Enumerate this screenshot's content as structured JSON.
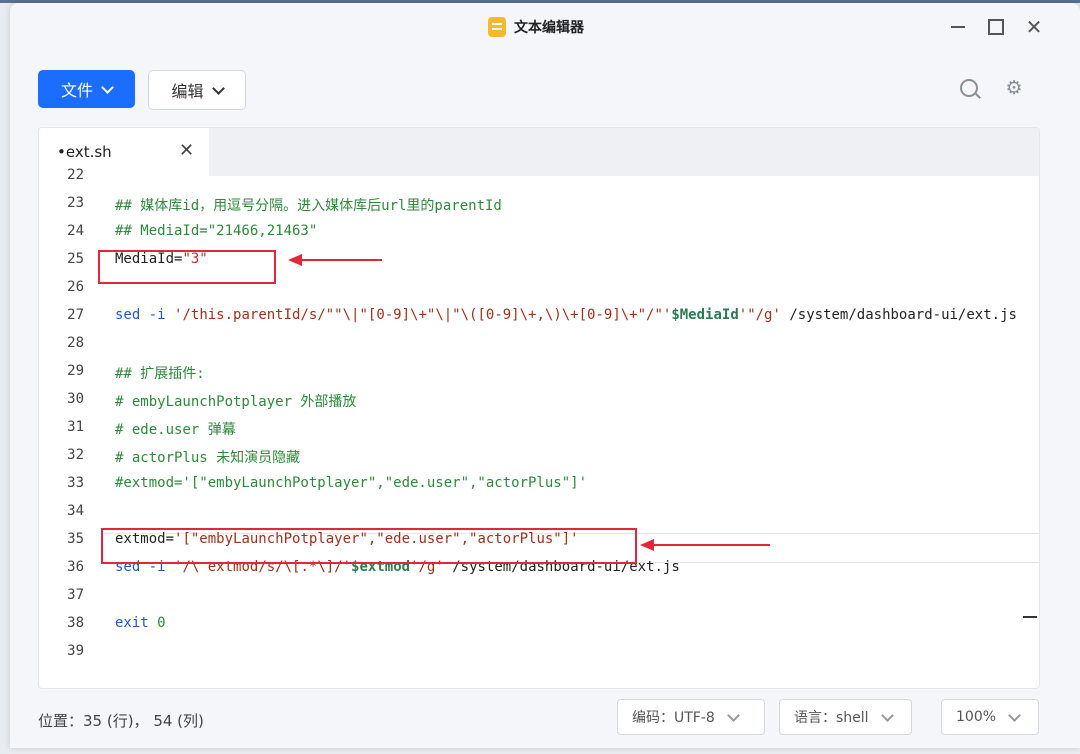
{
  "window": {
    "title": "文本编辑器"
  },
  "toolbar": {
    "file_label": "文件",
    "edit_label": "编辑"
  },
  "tab": {
    "name": "ext.sh",
    "modified_marker": "•"
  },
  "editor": {
    "lines": [
      {
        "n": "22",
        "segments": []
      },
      {
        "n": "23",
        "segments": [
          {
            "t": "## 媒体库id，用逗号分隔。进入媒体库后url里的parentId",
            "c": "c-comment"
          }
        ]
      },
      {
        "n": "24",
        "segments": [
          {
            "t": "## MediaId=\"21466,21463\"",
            "c": "c-comment"
          }
        ]
      },
      {
        "n": "25",
        "segments": [
          {
            "t": "MediaId=",
            "c": ""
          },
          {
            "t": "\"3\"",
            "c": "c-str"
          }
        ]
      },
      {
        "n": "26",
        "segments": []
      },
      {
        "n": "27",
        "segments": [
          {
            "t": "sed",
            "c": "c-kw"
          },
          {
            "t": " ",
            "c": ""
          },
          {
            "t": "-i",
            "c": "c-kw"
          },
          {
            "t": " ",
            "c": ""
          },
          {
            "t": "'/this.parentId/s/\"\"\\|\"[0-9]\\+\"\\|\"\\([0-9]\\+,\\)\\+[0-9]\\+\"/\"'",
            "c": "c-str2"
          },
          {
            "t": "$MediaId",
            "c": "c-var"
          },
          {
            "t": "'\"/g'",
            "c": "c-str2"
          },
          {
            "t": " /system/dashboard-ui/ext.js",
            "c": ""
          }
        ]
      },
      {
        "n": "28",
        "segments": []
      },
      {
        "n": "29",
        "segments": [
          {
            "t": "## 扩展插件:",
            "c": "c-comment"
          }
        ]
      },
      {
        "n": "30",
        "segments": [
          {
            "t": "# embyLaunchPotplayer 外部播放",
            "c": "c-comment"
          }
        ]
      },
      {
        "n": "31",
        "segments": [
          {
            "t": "# ede.user 弹幕",
            "c": "c-comment"
          }
        ]
      },
      {
        "n": "32",
        "segments": [
          {
            "t": "# actorPlus 未知演员隐藏",
            "c": "c-comment"
          }
        ]
      },
      {
        "n": "33",
        "segments": [
          {
            "t": "#extmod='[\"embyLaunchPotplayer\",\"ede.user\",\"actorPlus\"]'",
            "c": "c-comment"
          }
        ]
      },
      {
        "n": "34",
        "segments": []
      },
      {
        "n": "35",
        "segments": [
          {
            "t": "extmod=",
            "c": ""
          },
          {
            "t": "'[\"embyLaunchPotplayer\",\"ede.user\",\"actorPlus\"]'",
            "c": "c-str2"
          }
        ]
      },
      {
        "n": "36",
        "segments": [
          {
            "t": "sed",
            "c": "c-kw"
          },
          {
            "t": " ",
            "c": ""
          },
          {
            "t": "-i",
            "c": "c-kw"
          },
          {
            "t": " ",
            "c": ""
          },
          {
            "t": "'/\\ extmod/s/\\[.*\\]/'",
            "c": "c-str2"
          },
          {
            "t": "$extmod",
            "c": "c-var"
          },
          {
            "t": "'/g'",
            "c": "c-str2"
          },
          {
            "t": " /system/dashboard-ui/ext.js",
            "c": ""
          }
        ]
      },
      {
        "n": "37",
        "segments": []
      },
      {
        "n": "38",
        "segments": [
          {
            "t": "exit",
            "c": "c-kw"
          },
          {
            "t": " ",
            "c": ""
          },
          {
            "t": "0",
            "c": "c-num"
          }
        ]
      },
      {
        "n": "39",
        "segments": []
      }
    ]
  },
  "status": {
    "position": "位置：35 (行)， 54 (列)",
    "encoding": "编码：UTF-8",
    "language": "语言：shell",
    "zoom": "100%"
  },
  "colors": {
    "accent": "#1a6dff",
    "annotation": "#e3263a"
  }
}
